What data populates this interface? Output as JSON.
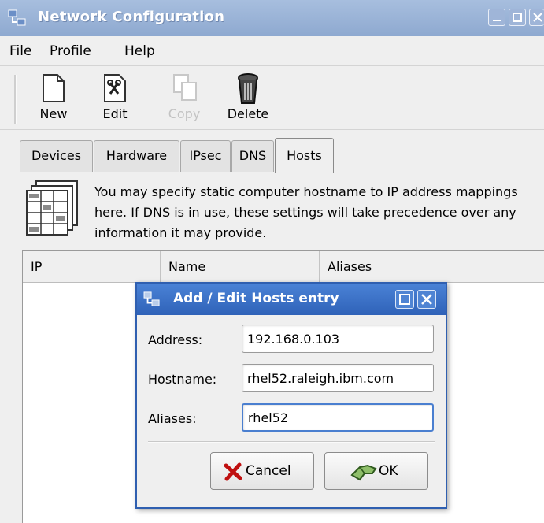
{
  "window": {
    "title": "Network Configuration"
  },
  "menu": {
    "file": "File",
    "profile": "Profile",
    "help": "Help"
  },
  "toolbar": {
    "new": "New",
    "edit": "Edit",
    "copy": "Copy",
    "delete": "Delete"
  },
  "tabs": [
    "Devices",
    "Hardware",
    "IPsec",
    "DNS",
    "Hosts"
  ],
  "hosts_tab": {
    "description": "You may specify static computer hostname to IP address mappings here.  If DNS is in use, these settings will take precedence over any information it may provide.",
    "columns": [
      "IP",
      "Name",
      "Aliases"
    ]
  },
  "dialog": {
    "title": "Add / Edit Hosts entry",
    "address_label": "Address:",
    "address_value": "192.168.0.103",
    "hostname_label": "Hostname:",
    "hostname_value": "rhel52.raleigh.ibm.com",
    "aliases_label": "Aliases:",
    "aliases_value": "rhel52",
    "cancel_label": "Cancel",
    "ok_label": "OK"
  },
  "colors": {
    "title_bar": "#8ea9d0",
    "dialog_title": "#3a6fc4"
  },
  "icons": [
    "network-app-icon",
    "minimize-icon",
    "maximize-icon",
    "close-icon",
    "new-document-icon",
    "edit-icon",
    "copy-icon",
    "delete-trash-icon",
    "hosts-table-icon",
    "cancel-x-icon",
    "ok-hand-icon"
  ]
}
